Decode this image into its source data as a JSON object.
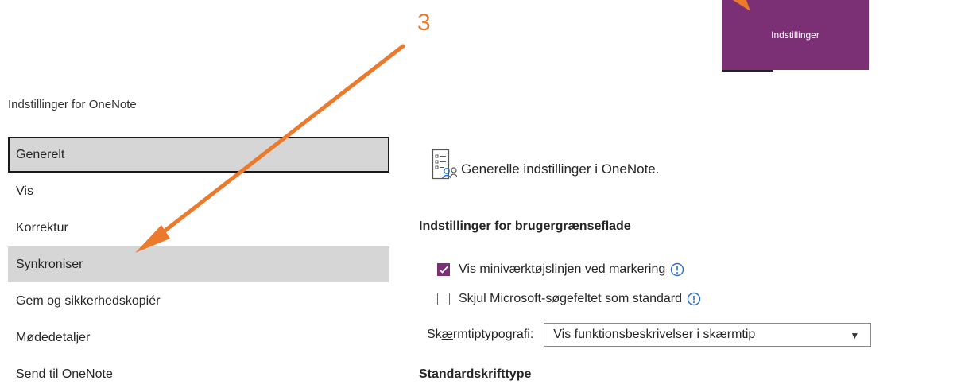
{
  "ribbon": {
    "settings_button_label": "Indstillinger"
  },
  "annotation": {
    "step_number": "3",
    "arrow_color": "#ec7a2c"
  },
  "dialog": {
    "title": "Indstillinger for OneNote"
  },
  "nav": {
    "items": [
      {
        "label": "Generelt",
        "state": "selected"
      },
      {
        "label": "Vis",
        "state": "normal"
      },
      {
        "label": "Korrektur",
        "state": "normal"
      },
      {
        "label": "Synkroniser",
        "state": "hovered"
      },
      {
        "label": "Gem og sikkerhedskopiér",
        "state": "normal"
      },
      {
        "label": "Mødedetaljer",
        "state": "normal"
      },
      {
        "label": "Send til OneNote",
        "state": "normal"
      }
    ]
  },
  "pane": {
    "heading": "Generelle indstillinger i OneNote.",
    "heading_icon": "general-settings-icon",
    "ui_options_heading": "Indstillinger for brugergrænseflade",
    "options": [
      {
        "label_pre": "Vis miniværktøjslinjen ve",
        "label_mnemonic": "d",
        "label_post": " markering",
        "checked": true
      },
      {
        "label": "Skjul Microsoft-søgefeltet som standard",
        "checked": false
      }
    ],
    "screentip": {
      "label_pre": "Sk",
      "label_mnemonic": "æ",
      "label_post": "rmtiptypografi:",
      "value": "Vis funktionsbeskrivelser i skærmtip"
    },
    "default_font_heading": "Standardskrifttype"
  },
  "colors": {
    "accent": "#7b2f74",
    "annotation": "#ec7a2c",
    "info": "#2b6fc4"
  }
}
